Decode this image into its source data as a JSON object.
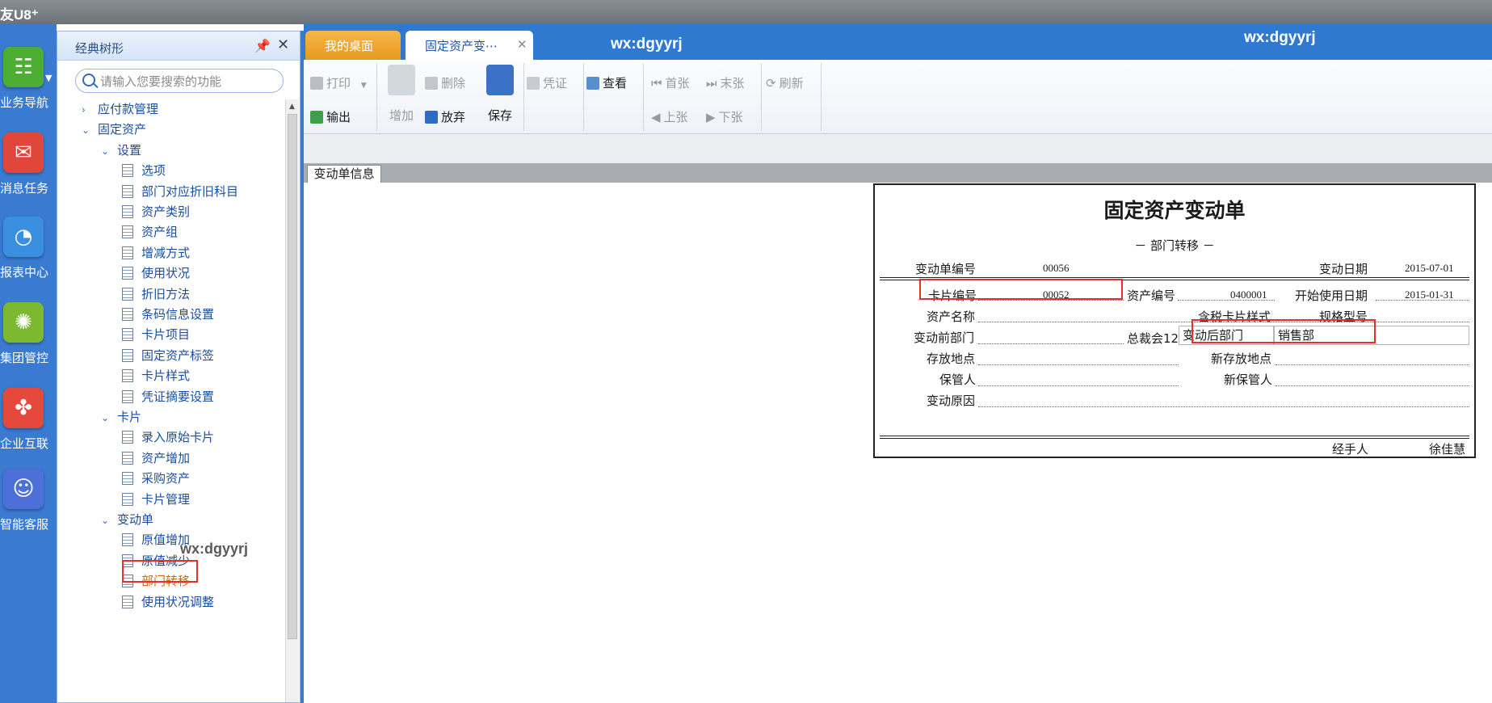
{
  "app": {
    "brand": "友U8⁺"
  },
  "leftbar": {
    "items": [
      {
        "label": "业务导航",
        "icon": "business-nav-icon",
        "color": "#4cae32"
      },
      {
        "label": "消息任务",
        "icon": "message-task-icon",
        "color": "#e0473a"
      },
      {
        "label": "报表中心",
        "icon": "report-center-icon",
        "color": "#3b8fe0"
      },
      {
        "label": "集团管控",
        "icon": "group-control-icon",
        "color": "#7cb931"
      },
      {
        "label": "企业互联",
        "icon": "enterprise-link-icon",
        "color": "#e5493b"
      },
      {
        "label": "智能客服",
        "icon": "smart-service-icon",
        "color": "#4d6fd8"
      }
    ]
  },
  "tree_panel": {
    "title": "经典树形",
    "search_placeholder": "请输入您要搜索的功能",
    "watermark": "wx:dgyyrj",
    "rows": [
      {
        "label": "应付款管理",
        "type": "collapsed"
      },
      {
        "label": "固定资产",
        "type": "expanded"
      },
      {
        "label": "设置",
        "type": "expanded"
      },
      {
        "label": "选项",
        "type": "leaf"
      },
      {
        "label": "部门对应折旧科目",
        "type": "leaf"
      },
      {
        "label": "资产类别",
        "type": "leaf"
      },
      {
        "label": "资产组",
        "type": "leaf"
      },
      {
        "label": "增减方式",
        "type": "leaf"
      },
      {
        "label": "使用状况",
        "type": "leaf"
      },
      {
        "label": "折旧方法",
        "type": "leaf"
      },
      {
        "label": "条码信息设置",
        "type": "leaf"
      },
      {
        "label": "卡片项目",
        "type": "leaf"
      },
      {
        "label": "固定资产标签",
        "type": "leaf"
      },
      {
        "label": "卡片样式",
        "type": "leaf"
      },
      {
        "label": "凭证摘要设置",
        "type": "leaf"
      },
      {
        "label": "卡片",
        "type": "expanded"
      },
      {
        "label": "录入原始卡片",
        "type": "leaf"
      },
      {
        "label": "资产增加",
        "type": "leaf"
      },
      {
        "label": "采购资产",
        "type": "leaf"
      },
      {
        "label": "卡片管理",
        "type": "leaf"
      },
      {
        "label": "变动单",
        "type": "expanded"
      },
      {
        "label": "原值增加",
        "type": "leaf"
      },
      {
        "label": "原值减少",
        "type": "leaf"
      },
      {
        "label": "部门转移",
        "type": "leaf",
        "active": true
      },
      {
        "label": "使用状况调整",
        "type": "leaf"
      }
    ]
  },
  "tabs": [
    {
      "label": "我的桌面"
    },
    {
      "label": "固定资产变⋯"
    }
  ],
  "watermarks": [
    "wx:dgyyrj",
    "wx:dgyyrj"
  ],
  "toolbar": {
    "print": "打印",
    "export": "输出",
    "add": "增加",
    "delete": "删除",
    "discard": "放弃",
    "save": "保存",
    "voucher": "凭证",
    "view": "查看",
    "first": "首张",
    "last": "末张",
    "prev": "上张",
    "next": "下张",
    "refresh": "刷新"
  },
  "strip_tab": "变动单信息",
  "form": {
    "title": "固定资产变动单",
    "subtitle": "－ 部门转移 －",
    "change_no_label": "变动单编号",
    "change_no": "00056",
    "change_date_label": "变动日期",
    "change_date": "2015-07-01",
    "card_no_label": "卡片编号",
    "card_no": "00052",
    "asset_no_label": "资产编号",
    "asset_no": "0400001",
    "start_date_label": "开始使用日期",
    "start_date": "2015-01-31",
    "asset_name_label": "资产名称",
    "tax_card_label": "含税卡片样式",
    "spec_label": "规格型号",
    "before_dept_label": "变动前部门",
    "before_dept_value": "总裁会12",
    "after_dept_label": "变动后部门",
    "after_dept_value": "销售部",
    "location_label": "存放地点",
    "new_location_label": "新存放地点",
    "keeper_label": "保管人",
    "new_keeper_label": "新保管人",
    "reason_label": "变动原因",
    "handler_label": "经手人",
    "handler": "徐佳慧"
  }
}
